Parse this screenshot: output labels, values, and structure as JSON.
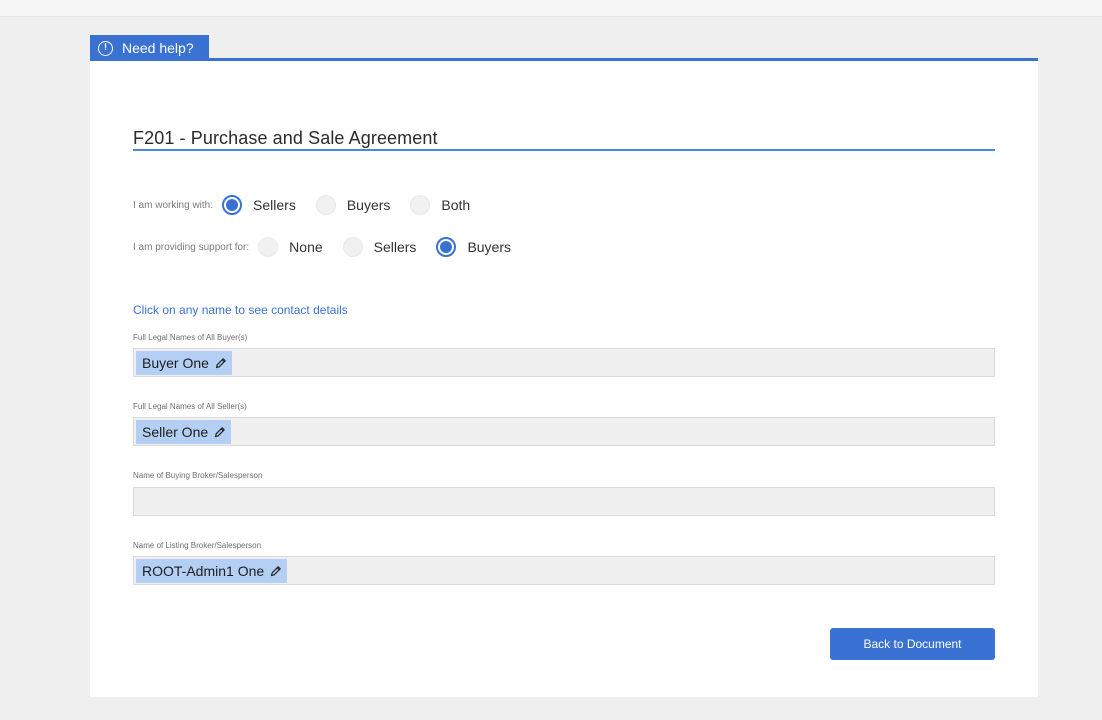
{
  "help_tab": {
    "icon": "info-icon",
    "label": "Need help?"
  },
  "form": {
    "title": "F201 - Purchase and Sale Agreement",
    "working_with": {
      "label": "I am working with:",
      "options": [
        "Sellers",
        "Buyers",
        "Both"
      ],
      "selected": "Sellers"
    },
    "support_for": {
      "label": "I am providing support for:",
      "options": [
        "None",
        "Sellers",
        "Buyers"
      ],
      "selected": "Buyers"
    },
    "contact_hint": "Click on any name to see contact details",
    "fields": [
      {
        "label": "Full Legal Names of All Buyer(s)",
        "value": "Buyer One"
      },
      {
        "label": "Full Legal Names of All Seller(s)",
        "value": "Seller One"
      },
      {
        "label": "Name of Buying Broker/Salesperson",
        "value": ""
      },
      {
        "label": "Name of Listing Broker/Salesperson",
        "value": "ROOT-Admin1 One"
      }
    ],
    "back_button": "Back to Document"
  },
  "colors": {
    "accent": "#3a72d3",
    "chip": "#b3cff3",
    "field_bg": "#f0f0f0"
  }
}
